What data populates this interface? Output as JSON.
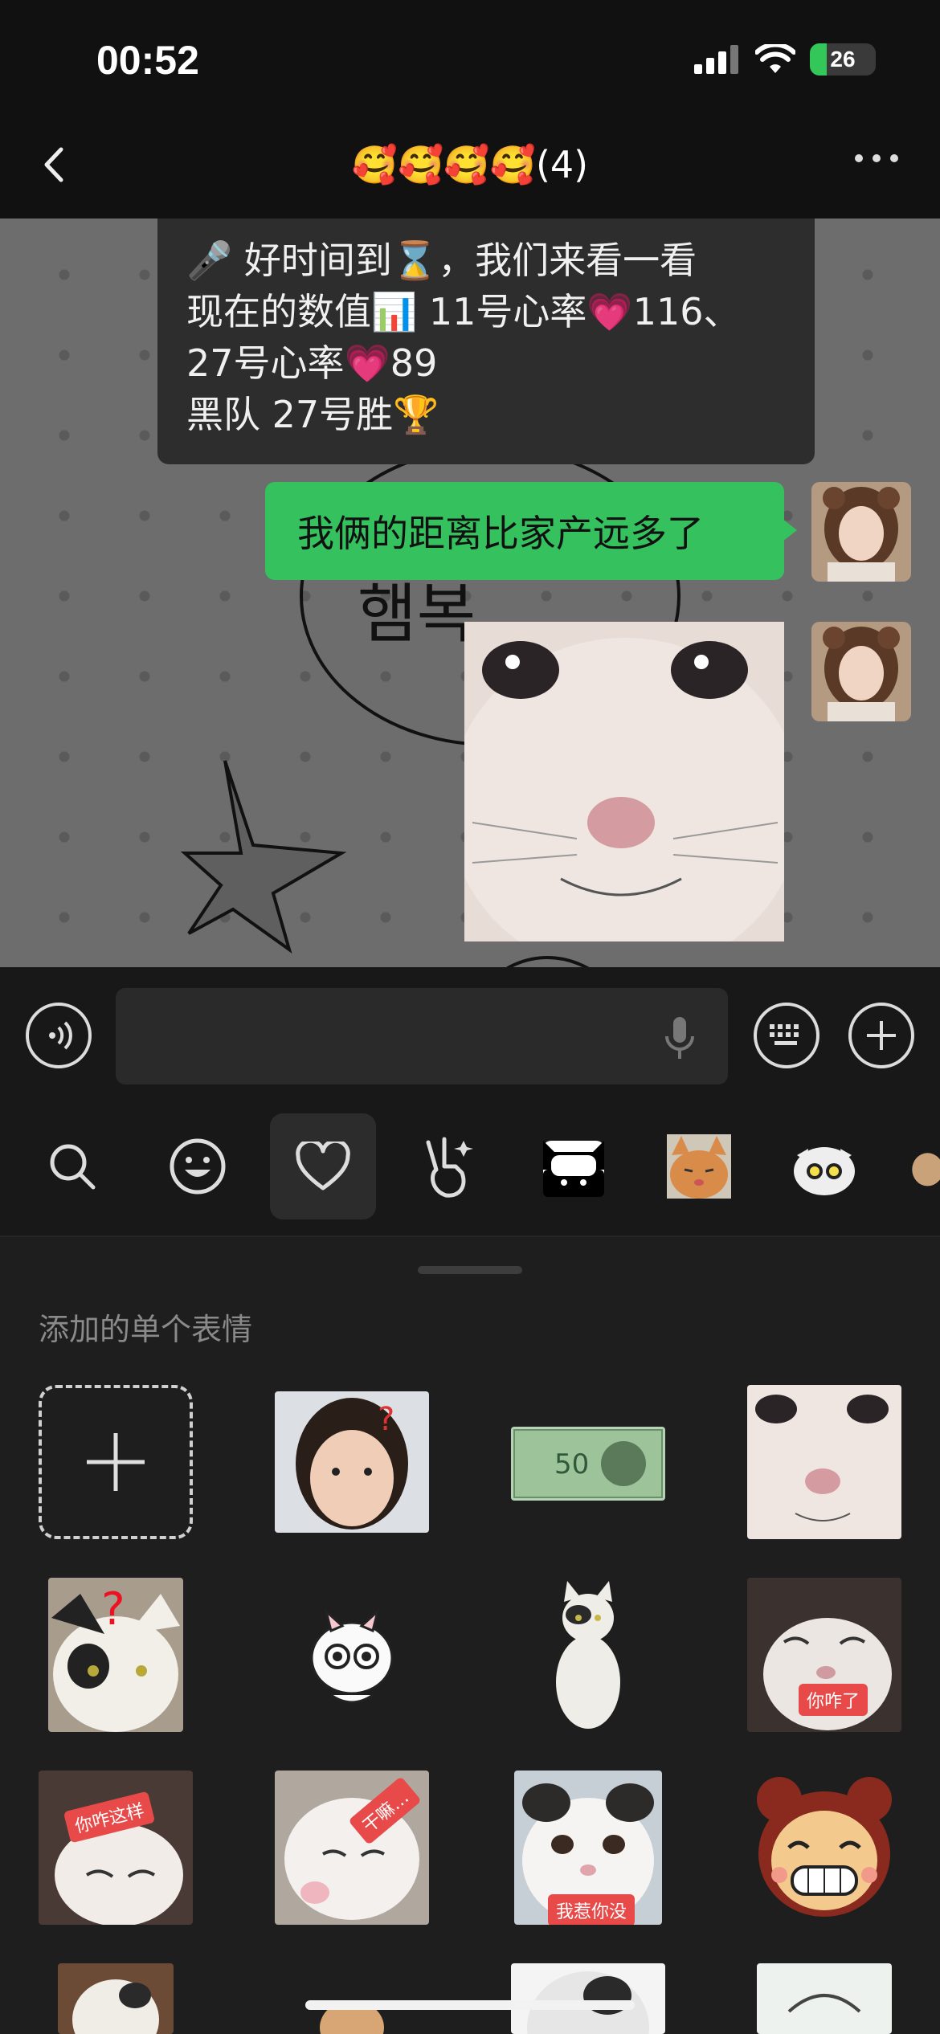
{
  "status": {
    "time": "00:52",
    "battery": "26"
  },
  "nav": {
    "title": "🥰🥰🥰🥰(4)"
  },
  "messages": {
    "system_lines": [
      "🎤 好时间到⌛，我们来看一看",
      "现在的数值📊 11号心率💗116、",
      "27号心率💗89",
      "黑队 27号胜🏆"
    ],
    "my_text": "我俩的距离比家产远多了",
    "background_doodle": "햄복"
  },
  "stickers": {
    "section_label": "添加的单个表情",
    "tags": {
      "t1": "你咋了",
      "t2": "你咋这样",
      "t3": "干嘛…",
      "t4": "我惹你没"
    }
  },
  "icons": {
    "voice": "voice-icon",
    "mic": "mic-icon",
    "emoji_keyboard": "keyboard-icon",
    "plus": "plus-icon",
    "search": "search-icon",
    "smile": "smiley-icon",
    "heart": "heart-icon",
    "hand": "peace-hand-icon"
  },
  "colors": {
    "accent_green": "#35c15e",
    "tag_red": "#e84a4a"
  }
}
